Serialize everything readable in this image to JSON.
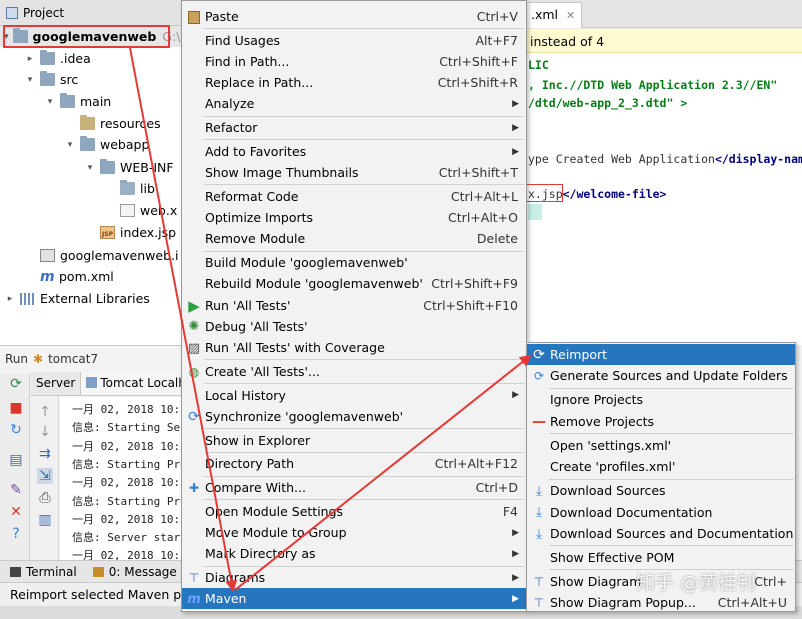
{
  "project_panel": {
    "title": "Project",
    "tree": [
      {
        "label": "googlemavenweb",
        "suffix": "G:\\v",
        "icon": "module-folder-icon",
        "depth": 0,
        "arrow": "▾"
      },
      {
        "label": ".idea",
        "icon": "folder-icon",
        "depth": 1,
        "arrow": "▸"
      },
      {
        "label": "src",
        "icon": "folder-icon",
        "depth": 1,
        "arrow": "▾"
      },
      {
        "label": "main",
        "icon": "folder-icon",
        "depth": 2,
        "arrow": "▾"
      },
      {
        "label": "resources",
        "icon": "resources-folder-icon",
        "depth": 3,
        "arrow": ""
      },
      {
        "label": "webapp",
        "icon": "webapp-folder-icon",
        "depth": 3,
        "arrow": "▾"
      },
      {
        "label": "WEB-INF",
        "icon": "folder-icon",
        "depth": 4,
        "arrow": "▾"
      },
      {
        "label": "lib",
        "icon": "lib-folder-icon",
        "depth": 5,
        "arrow": ""
      },
      {
        "label": "web.x",
        "icon": "web-xml-icon",
        "depth": 5,
        "arrow": ""
      },
      {
        "label": "index.jsp",
        "icon": "jsp-file-icon",
        "depth": 4,
        "arrow": ""
      },
      {
        "label": "googlemavenweb.i",
        "icon": "iml-file-icon",
        "depth": 1,
        "arrow": ""
      },
      {
        "label": "pom.xml",
        "icon": "maven-icon",
        "depth": 1,
        "arrow": ""
      },
      {
        "label": "External Libraries",
        "icon": "libraries-icon",
        "depth": 0,
        "arrow": "▸"
      }
    ]
  },
  "run_panel": {
    "label": "Run",
    "config": "tomcat7",
    "tabs": [
      "Server",
      "Tomcat Localh"
    ],
    "log_lines": [
      "一月 02, 2018 10:3",
      "信息: Starting Ser",
      "一月 02, 2018 10:3",
      "信息: Starting Pro",
      "一月 02, 2018 10:3",
      "信息: Starting Pro",
      "一月 02, 2018 10:3",
      "信息: Server start",
      "一月 02, 2018 10:3"
    ]
  },
  "bottom_tabs": [
    "Terminal",
    "0: Message"
  ],
  "status_text": "Reimport selected Maven pro",
  "editor": {
    "tab_label": ".xml",
    "notice": "instead of 4",
    "lines": [
      {
        "text": "LIC",
        "style": "str"
      },
      {
        "text": ", Inc.//DTD Web Application 2.3//EN\"",
        "style": "str"
      },
      {
        "text": "/dtd/web-app_2_3.dtd\" >",
        "style": "str"
      },
      {
        "text": "ype Created Web Application</display-name>",
        "style": "mixed"
      },
      {
        "text": "x.jsp</welcome-file>",
        "style": "mixed"
      }
    ]
  },
  "context_menu": {
    "items": [
      {
        "label": "Paste",
        "shortcut": "Ctrl+V",
        "icon": "paste-icon"
      },
      {
        "sep": true
      },
      {
        "label": "Find Usages",
        "shortcut": "Alt+F7"
      },
      {
        "label": "Find in Path...",
        "shortcut": "Ctrl+Shift+F"
      },
      {
        "label": "Replace in Path...",
        "shortcut": "Ctrl+Shift+R"
      },
      {
        "label": "Analyze",
        "submenu": true
      },
      {
        "sep": true
      },
      {
        "label": "Refactor",
        "submenu": true
      },
      {
        "sep": true
      },
      {
        "label": "Add to Favorites",
        "submenu": true
      },
      {
        "label": "Show Image Thumbnails",
        "shortcut": "Ctrl+Shift+T"
      },
      {
        "sep": true
      },
      {
        "label": "Reformat Code",
        "shortcut": "Ctrl+Alt+L"
      },
      {
        "label": "Optimize Imports",
        "shortcut": "Ctrl+Alt+O"
      },
      {
        "label": "Remove Module",
        "shortcut": "Delete"
      },
      {
        "sep": true
      },
      {
        "label": "Build Module 'googlemavenweb'"
      },
      {
        "label": "Rebuild Module 'googlemavenweb'",
        "shortcut": "Ctrl+Shift+F9"
      },
      {
        "label": "Run 'All Tests'",
        "shortcut": "Ctrl+Shift+F10",
        "icon": "run-icon"
      },
      {
        "label": "Debug 'All Tests'",
        "icon": "debug-icon"
      },
      {
        "label": "Run 'All Tests' with Coverage",
        "icon": "coverage-icon"
      },
      {
        "sep": true
      },
      {
        "label": "Create 'All Tests'...",
        "icon": "create-test-icon"
      },
      {
        "sep": true
      },
      {
        "label": "Local History",
        "submenu": true
      },
      {
        "label": "Synchronize 'googlemavenweb'",
        "icon": "sync-icon"
      },
      {
        "sep": true
      },
      {
        "label": "Show in Explorer"
      },
      {
        "sep": true
      },
      {
        "label": "Directory Path",
        "shortcut": "Ctrl+Alt+F12"
      },
      {
        "sep": true
      },
      {
        "label": "Compare With...",
        "shortcut": "Ctrl+D",
        "icon": "compare-icon"
      },
      {
        "sep": true
      },
      {
        "label": "Open Module Settings",
        "shortcut": "F4"
      },
      {
        "label": "Move Module to Group",
        "submenu": true
      },
      {
        "label": "Mark Directory as",
        "submenu": true
      },
      {
        "sep": true
      },
      {
        "label": "Diagrams",
        "submenu": true,
        "icon": "diagram-icon"
      },
      {
        "label": "Maven",
        "submenu": true,
        "icon": "maven-icon",
        "selected": true
      }
    ]
  },
  "maven_submenu": {
    "items": [
      {
        "label": "Reimport",
        "icon": "reimport-icon",
        "selected": true
      },
      {
        "label": "Generate Sources and Update Folders",
        "icon": "generate-sources-icon"
      },
      {
        "sep": true
      },
      {
        "label": "Ignore Projects"
      },
      {
        "label": "Remove Projects",
        "icon": "remove-icon"
      },
      {
        "sep": true
      },
      {
        "label": "Open 'settings.xml'"
      },
      {
        "label": "Create 'profiles.xml'"
      },
      {
        "sep": true
      },
      {
        "label": "Download Sources",
        "icon": "download-icon"
      },
      {
        "label": "Download Documentation",
        "icon": "download-icon"
      },
      {
        "label": "Download Sources and Documentation",
        "icon": "download-icon"
      },
      {
        "sep": true
      },
      {
        "label": "Show Effective POM"
      },
      {
        "sep": true
      },
      {
        "label": "Show Diagram",
        "shortcut": "Ctrl+",
        "icon": "diagram-icon"
      },
      {
        "label": "Show Diagram Popup...",
        "shortcut": "Ctrl+Alt+U",
        "icon": "diagram-icon"
      }
    ]
  },
  "watermark": "知乎 @黄桂钊",
  "colors": {
    "selection": "#2675bf",
    "annotation_red": "#e53935",
    "notice_bg": "#fffbd0"
  }
}
